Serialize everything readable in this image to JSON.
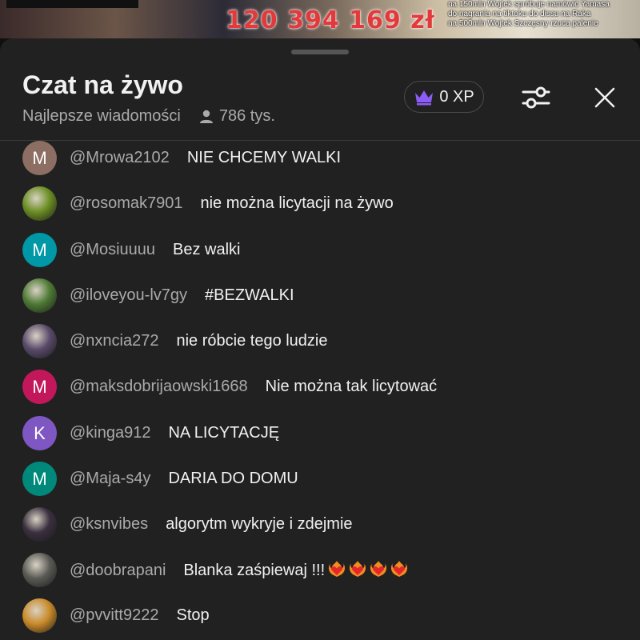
{
  "video": {
    "amount": "120 394 169 zł",
    "caption_lines": [
      "na 150mln Wojtek spróbuje namówić Yamasa",
      "do nagrania na tiktoku do dissu na Raka",
      "na 500mln Wojtek Szczęsny rzuca palenie"
    ]
  },
  "header": {
    "title": "Czat na żywo",
    "filter_label": "Najlepsze wiadomości",
    "viewers": "786 tys.",
    "xp": "0 XP"
  },
  "colors": {
    "panel_bg": "#212121",
    "author_text": "#aaaaaa",
    "message_text": "#f1f1f1",
    "crown": "#8b5cf6"
  },
  "messages": [
    {
      "author": "@Mrowa2102",
      "text": "NIE CHCEMY WALKI",
      "avatar_letter": "M",
      "avatar_color": "#8d6e63"
    },
    {
      "author": "@rosomak7901",
      "text": "nie można licytacji na żywo",
      "avatar_letter": "",
      "avatar_color": "#6b8e23"
    },
    {
      "author": "@Mosiuuuu",
      "text": "Bez walki",
      "avatar_letter": "M",
      "avatar_color": "#0097a7"
    },
    {
      "author": "@iloveyou-lv7gy",
      "text": "#BEZWALKI",
      "avatar_letter": "",
      "avatar_color": "#4e7a35"
    },
    {
      "author": "@nxncia272",
      "text": "nie róbcie tego ludzie",
      "avatar_letter": "",
      "avatar_color": "#5a4a6a"
    },
    {
      "author": "@maksdobrijaowski1668",
      "text": "Nie można tak licytować",
      "avatar_letter": "M",
      "avatar_color": "#c2185b"
    },
    {
      "author": "@kinga912",
      "text": "NA LICYTACJĘ",
      "avatar_letter": "K",
      "avatar_color": "#7e57c2"
    },
    {
      "author": "@Maja-s4y",
      "text": "DARIA DO DOMU",
      "avatar_letter": "M",
      "avatar_color": "#00897b"
    },
    {
      "author": "@ksnvibes",
      "text": "algorytm wykryje i zdejmie",
      "avatar_letter": "",
      "avatar_color": "#3a2f3f"
    },
    {
      "author": "@doobrapani",
      "text": "Blanka zaśpiewaj !!!",
      "avatar_letter": "",
      "avatar_color": "#5a5a55",
      "emoji": "heart-on-fire",
      "emoji_count": 4
    },
    {
      "author": "@pvvitt9222",
      "text": "Stop",
      "avatar_letter": "",
      "avatar_color": "#c98a2a"
    }
  ]
}
